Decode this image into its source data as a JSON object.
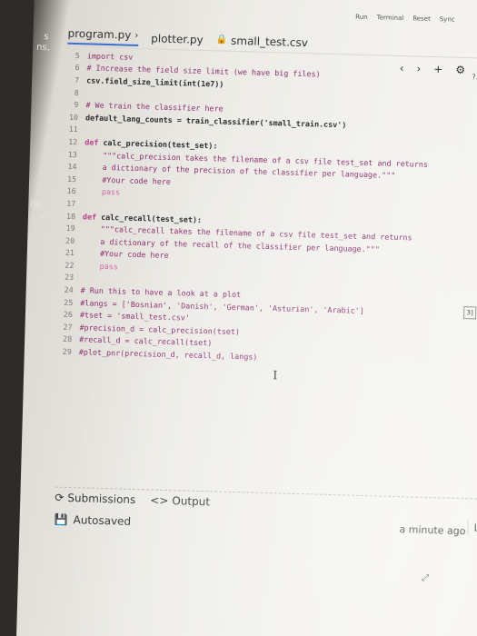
{
  "strip": {
    "lines": [
      {
        "text": "s"
      },
      {
        "text": "ns,"
      },
      {
        "text": "he"
      },
      {
        "text": "n"
      }
    ]
  },
  "run_bar": {
    "run": "Run",
    "terminal": "Terminal",
    "reset": "Reset",
    "sync": "Sync"
  },
  "tabs": [
    {
      "label": "program.py",
      "active": true
    },
    {
      "label": "plotter.py",
      "active": false
    },
    {
      "label": "small_test.csv",
      "active": false
    }
  ],
  "editor_ctrls": {
    "prev": "‹",
    "next": "›",
    "add": "+",
    "settings": "⚙"
  },
  "code": [
    {
      "n": "5",
      "parts": [
        {
          "c": "cm",
          "t": "import csv"
        }
      ]
    },
    {
      "n": "6",
      "parts": [
        {
          "c": "cm",
          "t": "# Increase the field size limit (we have big files)"
        }
      ]
    },
    {
      "n": "7",
      "parts": [
        {
          "c": "tx",
          "t": "csv.field_size_limit(int(1e7))"
        }
      ]
    },
    {
      "n": "8",
      "parts": []
    },
    {
      "n": "9",
      "parts": [
        {
          "c": "cm",
          "t": "# We train the classifier here"
        }
      ]
    },
    {
      "n": "10",
      "parts": [
        {
          "c": "tx",
          "t": "default_lang_counts = train_classifier('small_train.csv')"
        }
      ]
    },
    {
      "n": "11",
      "parts": []
    },
    {
      "n": "12",
      "parts": [
        {
          "c": "kw",
          "t": "def "
        },
        {
          "c": "tx",
          "t": "calc_precision(test_set):"
        }
      ]
    },
    {
      "n": "13",
      "parts": [
        {
          "c": "cm",
          "t": "    \"\"\"calc_precision takes the filename of a csv file test_set and returns"
        }
      ]
    },
    {
      "n": "14",
      "parts": [
        {
          "c": "cm",
          "t": "    a dictionary of the precision of the classifier per language.\"\"\""
        }
      ]
    },
    {
      "n": "15",
      "parts": [
        {
          "c": "cm",
          "t": "    #Your code here"
        }
      ]
    },
    {
      "n": "16",
      "parts": [
        {
          "c": "pass",
          "t": "    pass"
        }
      ]
    },
    {
      "n": "17",
      "parts": []
    },
    {
      "n": "18",
      "parts": [
        {
          "c": "kw",
          "t": "def "
        },
        {
          "c": "tx",
          "t": "calc_recall(test_set):"
        }
      ]
    },
    {
      "n": "19",
      "parts": [
        {
          "c": "cm",
          "t": "    \"\"\"calc_recall takes the filename of a csv file test_set and returns"
        }
      ]
    },
    {
      "n": "20",
      "parts": [
        {
          "c": "cm",
          "t": "    a dictionary of the recall of the classifier per language.\"\"\""
        }
      ]
    },
    {
      "n": "21",
      "parts": [
        {
          "c": "cm",
          "t": "    #Your code here"
        }
      ]
    },
    {
      "n": "22",
      "parts": [
        {
          "c": "pass",
          "t": "    pass"
        }
      ]
    },
    {
      "n": "23",
      "parts": []
    },
    {
      "n": "24",
      "parts": [
        {
          "c": "cm",
          "t": "# Run this to have a look at a plot"
        }
      ]
    },
    {
      "n": "25",
      "parts": [
        {
          "c": "cm",
          "t": "#langs = ['Bosnian', 'Danish', 'German', 'Asturian', 'Arabic']"
        }
      ]
    },
    {
      "n": "26",
      "parts": [
        {
          "c": "cm",
          "t": "#tset = 'small_test.csv'"
        }
      ]
    },
    {
      "n": "27",
      "parts": [
        {
          "c": "cm",
          "t": "#precision_d = calc_precision(tset)"
        }
      ]
    },
    {
      "n": "28",
      "parts": [
        {
          "c": "cm",
          "t": "#recall_d = calc_recall(tset)"
        }
      ]
    },
    {
      "n": "29",
      "parts": [
        {
          "c": "cm",
          "t": "#plot_pnr(precision_d, recall_d, langs)"
        }
      ]
    }
  ],
  "bottom_tabs": {
    "submissions": "Submissions",
    "output": "Output"
  },
  "status": {
    "autosaved": "Autosaved",
    "time": "a minute ago",
    "load": "Load"
  },
  "right_badge": "3]",
  "right_dots": "?..."
}
